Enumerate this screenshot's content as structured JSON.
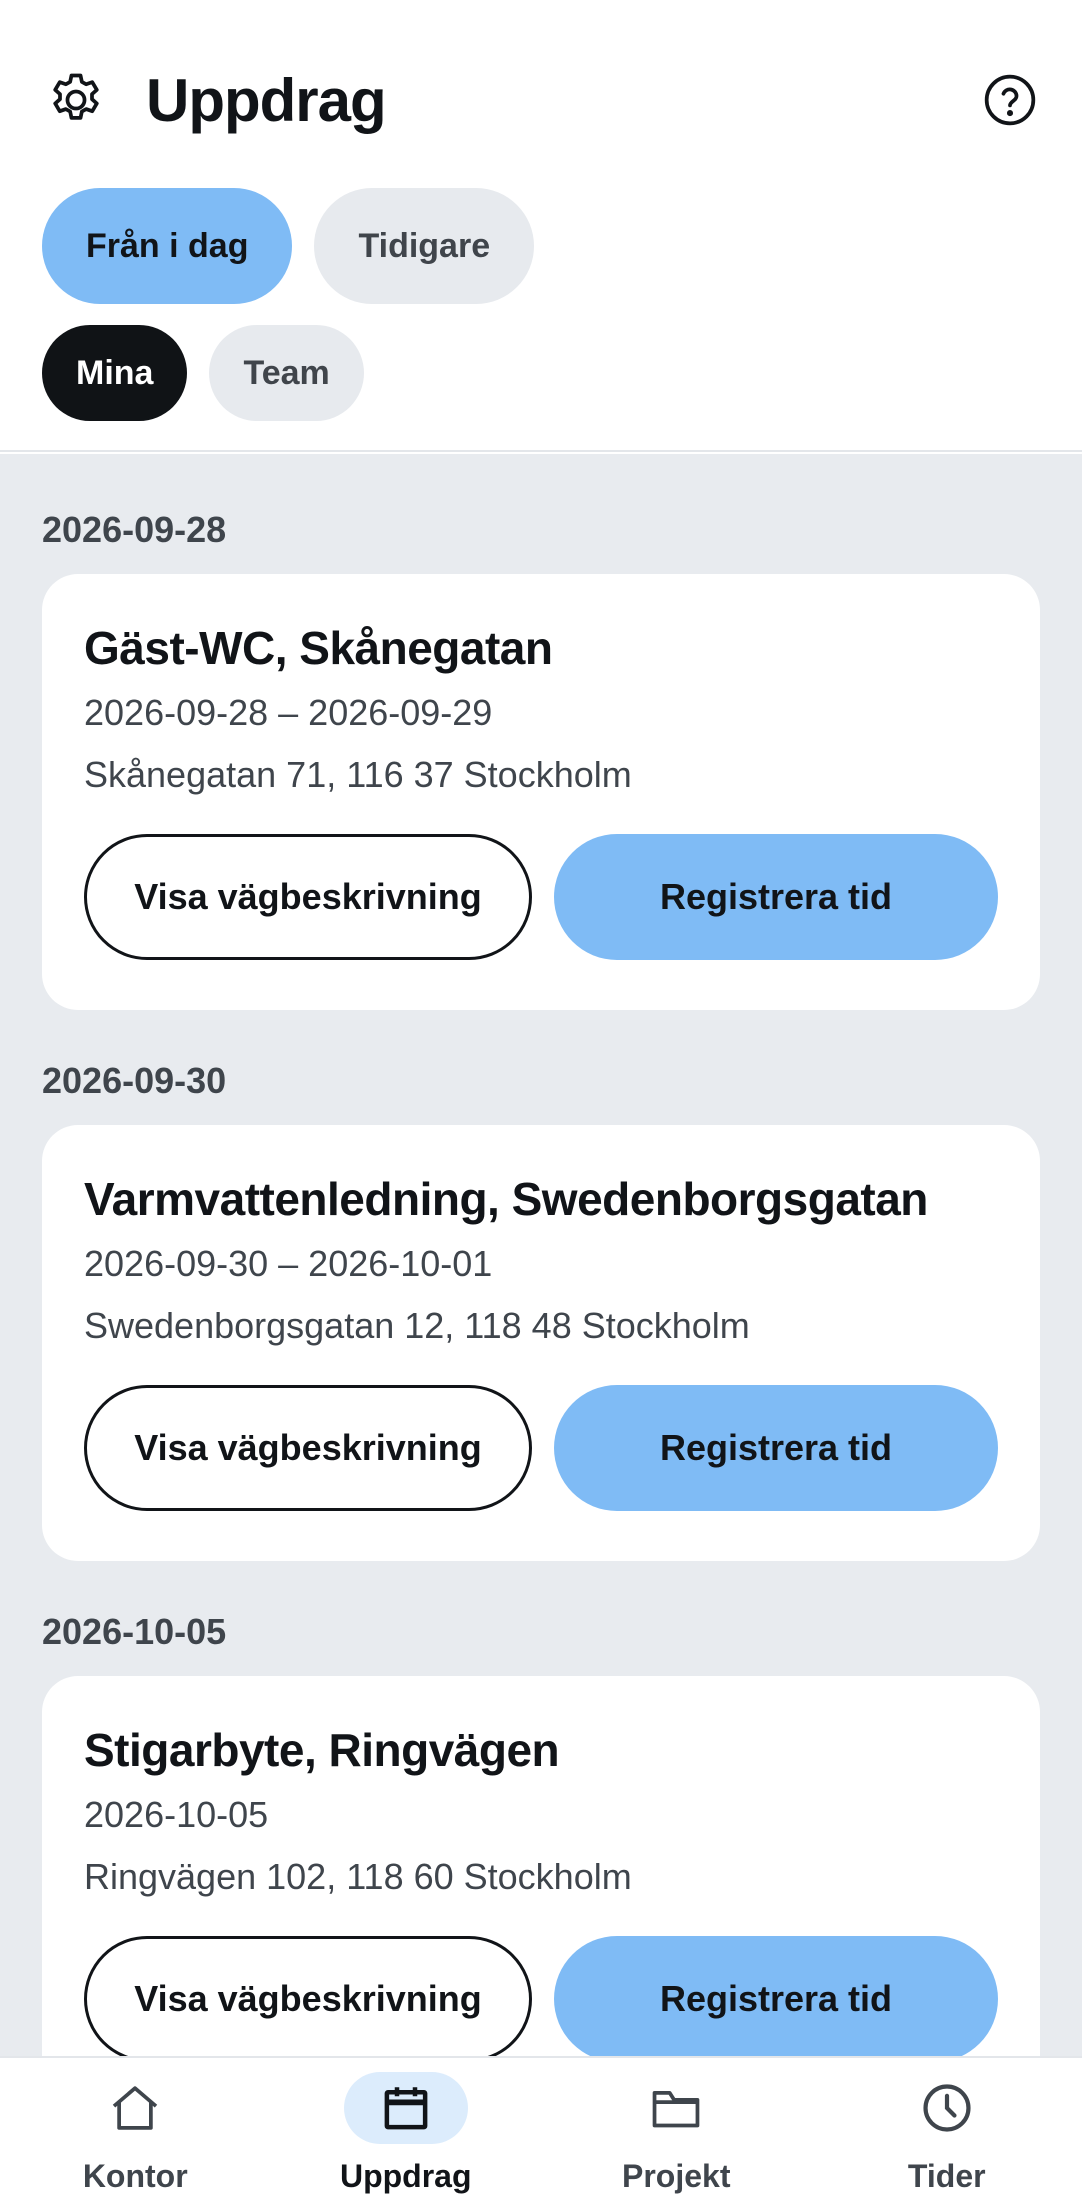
{
  "header": {
    "title": "Uppdrag",
    "settings_icon": "gear-icon",
    "help_icon": "question-circle-icon"
  },
  "filters": {
    "period": [
      {
        "label": "Från i dag",
        "selected": true
      },
      {
        "label": "Tidigare",
        "selected": false
      }
    ],
    "scope": [
      {
        "label": "Mina",
        "selected": true
      },
      {
        "label": "Team",
        "selected": false
      }
    ]
  },
  "assignments": [
    {
      "date": "2026-09-28",
      "title": "Gäst-WC, Skånegatan",
      "dates": "2026-09-28 – 2026-09-29",
      "address": "Skånegatan 71, 116 37 Stockholm",
      "directions_label": "Visa vägbeskrivning",
      "register_label": "Registrera tid"
    },
    {
      "date": "2026-09-30",
      "title": "Varmvattenledning, Swedenborgsgatan",
      "dates": "2026-09-30 – 2026-10-01",
      "address": "Swedenborgsgatan 12, 118 48 Stockholm",
      "directions_label": "Visa vägbeskrivning",
      "register_label": "Registrera tid"
    },
    {
      "date": "2026-10-05",
      "title": "Stigarbyte, Ringvägen",
      "dates": "2026-10-05",
      "address": "Ringvägen 102, 118 60 Stockholm",
      "directions_label": "Visa vägbeskrivning",
      "register_label": "Registrera tid"
    }
  ],
  "tabbar": {
    "items": [
      {
        "label": "Kontor",
        "icon": "home-icon",
        "active": false
      },
      {
        "label": "Uppdrag",
        "icon": "calendar-icon",
        "active": true
      },
      {
        "label": "Projekt",
        "icon": "folder-icon",
        "active": false
      },
      {
        "label": "Tider",
        "icon": "clock-icon",
        "active": false
      }
    ]
  },
  "colors": {
    "accent": "#7fbbf5",
    "dark_chip": "#101316",
    "gray_chip": "#e7eaee",
    "list_background": "#e8ebef",
    "active_tab_pill": "#dcecfc"
  }
}
